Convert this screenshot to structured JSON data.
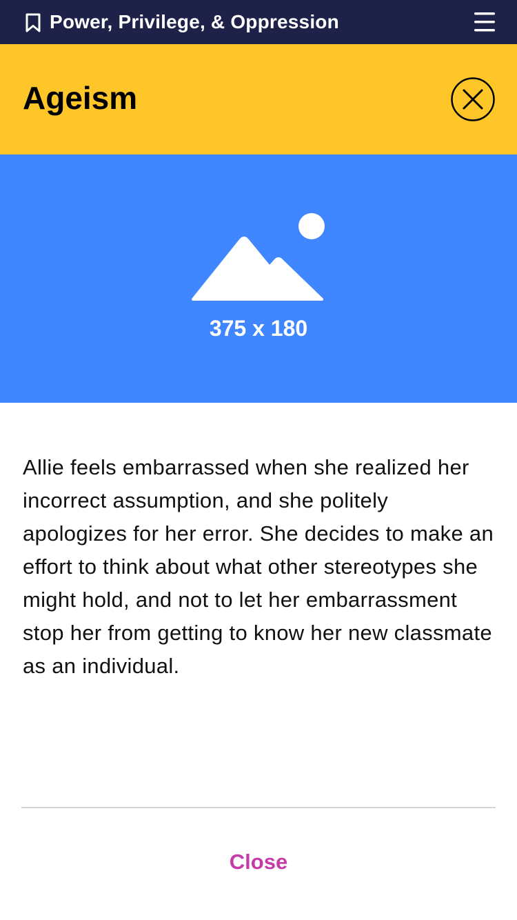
{
  "topbar": {
    "title": "Power, Privilege, & Oppression",
    "bookmark_icon": "bookmark-icon",
    "menu_icon": "hamburger-menu-icon"
  },
  "header": {
    "title": "Ageism",
    "close_icon": "close-circle-icon"
  },
  "image_placeholder": {
    "icon": "image-placeholder-icon",
    "dimensions_label": "375 x 180"
  },
  "content": {
    "paragraph": "Allie feels embarrassed when she realized her incorrect assumption, and she politely apologizes for her error. She decides to make an effort to think about what other stereotypes she might hold, and not to let her embarrassment stop her from getting to know her new classmate as an individual."
  },
  "footer": {
    "close_label": "Close"
  },
  "colors": {
    "topbar_bg": "#1e2249",
    "header_bg": "#ffc629",
    "image_bg": "#3f86ff",
    "close_link": "#c53ca6"
  }
}
